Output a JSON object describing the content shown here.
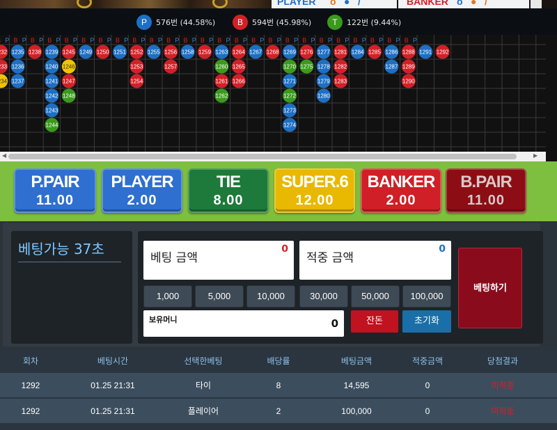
{
  "video": {
    "player_label": "PLAYER",
    "banker_label": "BANKER"
  },
  "stats": {
    "player": {
      "letter": "P",
      "text": "576번 (44.58%)",
      "color": "#1d6fc4"
    },
    "banker": {
      "letter": "B",
      "text": "594번 (45.98%)",
      "color": "#d32027"
    },
    "tie": {
      "letter": "T",
      "text": "122번 (9.44%)",
      "color": "#3a9a1c"
    }
  },
  "road": {
    "header": [
      "B",
      "P",
      "B",
      "P",
      "B",
      "P",
      "B",
      "P",
      "B",
      "P",
      "B",
      "P",
      "B",
      "P",
      "B",
      "P",
      "B",
      "P",
      "B",
      "P",
      "B",
      "P",
      "B",
      "P",
      "B",
      "P",
      "B",
      "P",
      "B",
      "P",
      "B",
      "P",
      "B",
      "P",
      "B",
      "P",
      "B",
      "P",
      "B",
      "P",
      "B",
      "P",
      "B",
      "P",
      "B",
      "P",
      "B",
      "P",
      "B",
      "P"
    ],
    "columns": [
      [
        [
          "1232",
          "B"
        ],
        [
          "1233",
          "B"
        ],
        [
          "1234",
          "S"
        ]
      ],
      [
        [
          "1235",
          "P"
        ],
        [
          "1236",
          "P"
        ],
        [
          "1237",
          "P"
        ]
      ],
      [
        [
          "1238",
          "B"
        ]
      ],
      [
        [
          "1239",
          "P"
        ],
        [
          "1240",
          "P"
        ],
        [
          "1241",
          "P"
        ],
        [
          "1242",
          "P"
        ],
        [
          "1243",
          "P"
        ],
        [
          "1244",
          "T"
        ]
      ],
      [
        [
          "1245",
          "B"
        ],
        [
          "1246",
          "S"
        ],
        [
          "1247",
          "B"
        ],
        [
          "1248",
          "T"
        ]
      ],
      [
        [
          "1249",
          "P"
        ]
      ],
      [
        [
          "1250",
          "B"
        ]
      ],
      [
        [
          "1251",
          "P"
        ]
      ],
      [
        [
          "1252",
          "B"
        ],
        [
          "1253",
          "B"
        ],
        [
          "1254",
          "B"
        ]
      ],
      [
        [
          "1255",
          "P"
        ]
      ],
      [
        [
          "1256",
          "B"
        ],
        [
          "1257",
          "B"
        ]
      ],
      [
        [
          "1258",
          "P"
        ]
      ],
      [
        [
          "1259",
          "B"
        ]
      ],
      [
        [
          "1263",
          "P"
        ],
        [
          "1260",
          "T"
        ],
        [
          "1261",
          "B"
        ],
        [
          "1262",
          "T"
        ]
      ],
      [
        [
          "1264",
          "B"
        ],
        [
          "1265",
          "B"
        ],
        [
          "1266",
          "B"
        ]
      ],
      [
        [
          "1267",
          "P"
        ]
      ],
      [
        [
          "1268",
          "B"
        ]
      ],
      [
        [
          "1269",
          "P"
        ],
        [
          "1270",
          "T"
        ],
        [
          "1271",
          "P"
        ],
        [
          "1272",
          "T"
        ],
        [
          "1273",
          "P"
        ],
        [
          "1274",
          "P"
        ]
      ],
      [
        [
          "1276",
          "B"
        ],
        [
          "1275",
          "T"
        ]
      ],
      [
        [
          "1277",
          "P"
        ],
        [
          "1278",
          "P"
        ],
        [
          "1279",
          "P"
        ],
        [
          "1280",
          "P"
        ]
      ],
      [
        [
          "1281",
          "B"
        ],
        [
          "1282",
          "B"
        ],
        [
          "1283",
          "B"
        ]
      ],
      [
        [
          "1284",
          "P"
        ]
      ],
      [
        [
          "1285",
          "B"
        ]
      ],
      [
        [
          "1286",
          "P"
        ],
        [
          "1287",
          "P"
        ]
      ],
      [
        [
          "1288",
          "B"
        ],
        [
          "1289",
          "B"
        ],
        [
          "1290",
          "B"
        ]
      ],
      [
        [
          "1291",
          "P"
        ]
      ],
      [
        [
          "1292",
          "B"
        ]
      ]
    ]
  },
  "bets": [
    {
      "name": "P.PAIR",
      "odds": "11.00",
      "bg": "#2f6fcf",
      "fg": "#ffffff"
    },
    {
      "name": "PLAYER",
      "odds": "2.00",
      "bg": "#2f6fcf",
      "fg": "#ffffff"
    },
    {
      "name": "TIE",
      "odds": "8.00",
      "bg": "#1d7a3a",
      "fg": "#ffffff"
    },
    {
      "name": "SUPER.6",
      "odds": "12.00",
      "bg": "#e9b800",
      "fg": "#ffffff"
    },
    {
      "name": "BANKER",
      "odds": "2.00",
      "bg": "#d01f26",
      "fg": "#ffffff"
    },
    {
      "name": "B.PAIR",
      "odds": "11.00",
      "bg": "#8c0d14",
      "fg": "#d9c8c8"
    }
  ],
  "control": {
    "timer": "베팅가능 37초",
    "bet_amount_label": "베팅 금액",
    "bet_amount_value": "0",
    "win_amount_label": "적중 금액",
    "win_amount_value": "0",
    "chips": [
      "1,000",
      "5,000",
      "10,000",
      "30,000",
      "50,000",
      "100,000"
    ],
    "holding_label": "보유머니",
    "holding_value": "0",
    "change_label": "잔돈",
    "reset_label": "초기화",
    "place_bet_label": "베팅하기"
  },
  "history": {
    "headers": [
      "회차",
      "베팅시간",
      "선택한베팅",
      "배당률",
      "베팅금액",
      "적중금액",
      "당첨결과"
    ],
    "rows": [
      [
        "1292",
        "01.25 21:31",
        "타이",
        "8",
        "14,595",
        "0",
        "미적중"
      ],
      [
        "1292",
        "01.25 21:31",
        "플레이어",
        "2",
        "100,000",
        "0",
        "미적중"
      ]
    ],
    "result_color": "#d32027"
  }
}
